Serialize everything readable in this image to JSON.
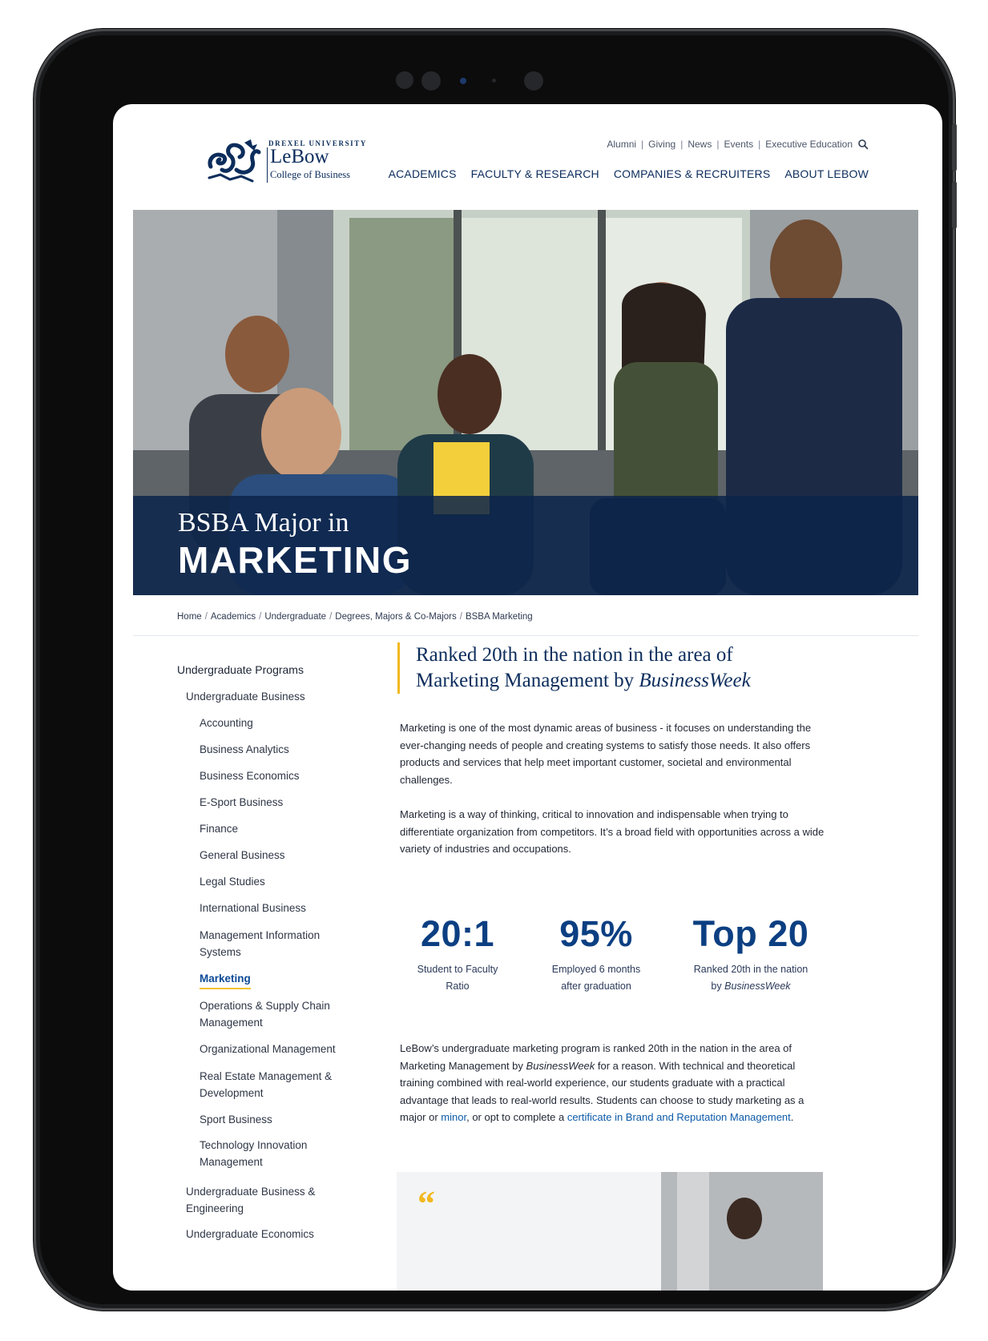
{
  "header": {
    "logo": {
      "university": "DREXEL UNIVERSITY",
      "name": "LeBow",
      "college": "College of Business"
    },
    "utility_nav": [
      "Alumni",
      "Giving",
      "News",
      "Events",
      "Executive Education"
    ],
    "main_nav": [
      "ACADEMICS",
      "FACULTY & RESEARCH",
      "COMPANIES & RECRUITERS",
      "ABOUT LEBOW"
    ]
  },
  "hero": {
    "subtitle": "BSBA Major in",
    "title": "MARKETING"
  },
  "breadcrumb": [
    "Home",
    "Academics",
    "Undergraduate",
    "Degrees, Majors & Co-Majors",
    "BSBA Marketing"
  ],
  "sidebar": {
    "heading": "Undergraduate Programs",
    "group": "Undergraduate Business",
    "items": [
      "Accounting",
      "Business Analytics",
      "Business Economics",
      "E-Sport Business",
      "Finance",
      "General Business",
      "Legal Studies",
      "International Business",
      "Management Information Systems",
      "Marketing",
      "Operations & Supply Chain Management",
      "Organizational Management",
      "Real Estate Management & Development",
      "Sport Business",
      "Technology Innovation Management"
    ],
    "active_item": "Marketing",
    "more_groups": [
      "Undergraduate Business & Engineering",
      "Undergraduate Economics"
    ]
  },
  "ranked": {
    "line1": "Ranked 20th in the nation in the area of",
    "line2_prefix": "Marketing Management by ",
    "line2_italic": "BusinessWeek"
  },
  "paragraphs": {
    "p1": "Marketing is one of the most dynamic areas of business - it focuses on understanding the ever-changing needs of people and creating systems to satisfy those needs. It also offers products and services that help meet important customer, societal and environmental challenges.",
    "p2": "Marketing is a way of thinking, critical to innovation and indispensable when trying to differentiate organization from competitors. It’s a broad field with opportunities across a wide variety of industries and occupations.",
    "p3_part1": "LeBow’s undergraduate marketing program is ranked 20th in the nation in the area of Marketing Management by ",
    "p3_italic": "BusinessWeek",
    "p3_part2": " for a reason. With technical and theoretical training combined with real-world experience, our students graduate with a practical advantage that leads to real-world results. Students can choose to study marketing as a major or ",
    "p3_link1": "minor",
    "p3_part3": ", or opt to complete a ",
    "p3_link2": "certificate in Brand and Reputation Management",
    "p3_end": "."
  },
  "stats": [
    {
      "value": "20:1",
      "label_line1": "Student to Faculty",
      "label_line2": "Ratio",
      "label_line2_italic": ""
    },
    {
      "value": "95%",
      "label_line1": "Employed 6 months",
      "label_line2": "after graduation",
      "label_line2_italic": ""
    },
    {
      "value": "Top 20",
      "label_line1": "Ranked 20th in the nation",
      "label_line2": "by ",
      "label_line2_italic": "BusinessWeek"
    }
  ],
  "quote": {
    "mark": "“"
  },
  "colors": {
    "navy": "#0c2d5c",
    "accent_gold": "#f2b81f",
    "link": "#0c5aa8",
    "stat_blue": "#0c3f82"
  }
}
